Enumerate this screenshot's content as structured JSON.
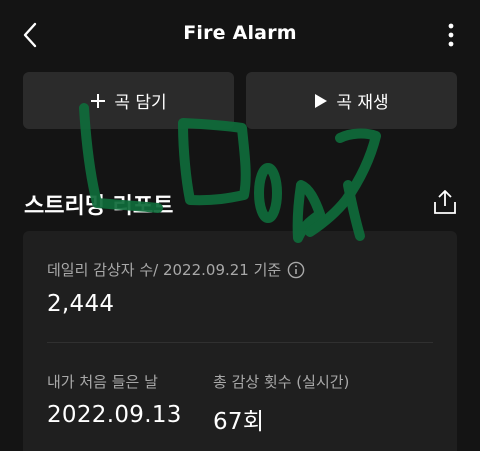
{
  "header": {
    "title": "Fire Alarm",
    "back_icon": "chevron-left-icon",
    "more_icon": "more-vertical-icon"
  },
  "actions": {
    "add_label": "곡 담기",
    "add_icon": "plus-icon",
    "play_label": "곡 재생",
    "play_icon": "play-icon"
  },
  "report": {
    "title": "스트리밍 리포트",
    "share_icon": "share-icon",
    "daily_label": "데일리 감상자 수/ 2022.09.21 기준",
    "daily_value": "2,444",
    "info_icon": "info-icon",
    "first_listen_label": "내가 처음 들은 날",
    "first_listen_value": "2022.09.13",
    "total_plays_label": "총 감상 횟수 (실시간)",
    "total_plays_value": "67회"
  },
  "annotation": {
    "handwriting": "LDO7L",
    "color": "#0f6b3a"
  },
  "colors": {
    "background": "#141414",
    "button_bg": "#2b2b2b",
    "card_bg": "#1f1f1f",
    "label_gray": "#a8a8a8"
  }
}
